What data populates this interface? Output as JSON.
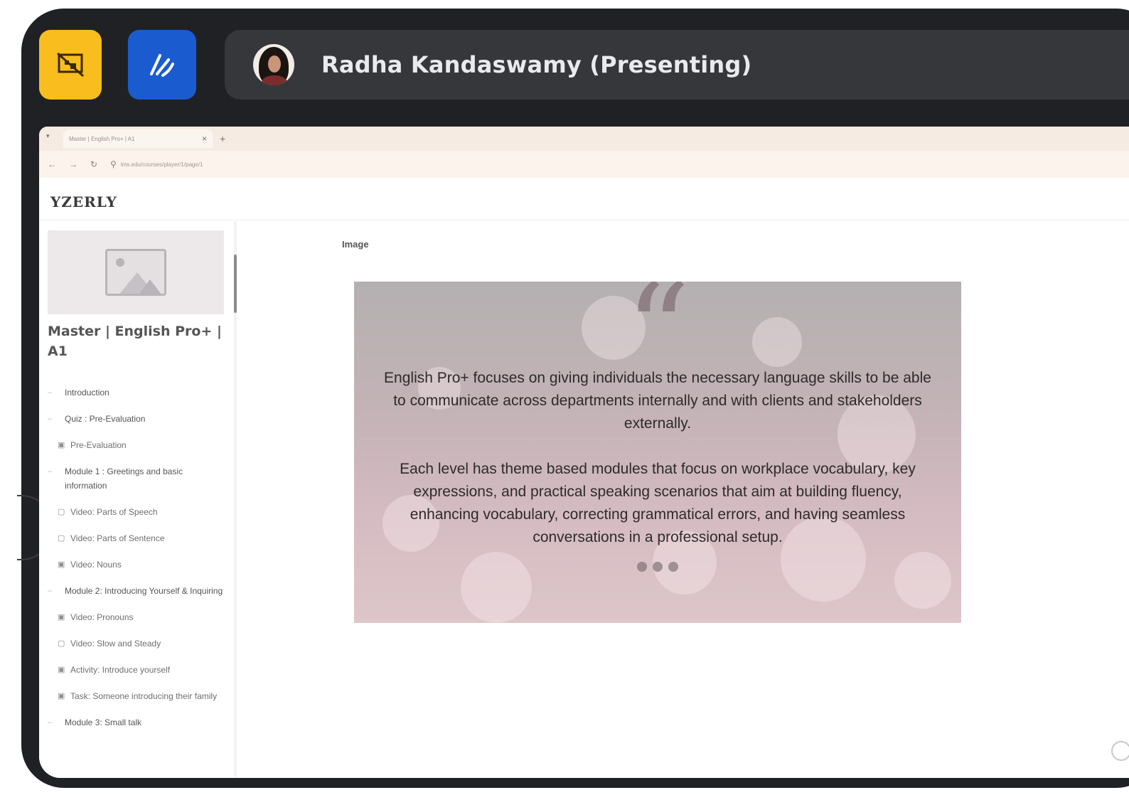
{
  "meeting": {
    "presenter_label": "Radha Kandaswamy (Presenting)",
    "accent_yellow": "#f9bd1d",
    "accent_blue": "#1a5bd0",
    "left_button_icon": "present-off-icon",
    "right_button_icon": "annotate-pen-icon"
  },
  "browser": {
    "tab_title": "Master | English Pro+ | A1",
    "url": "lms.edu/courses/player/1/page/1"
  },
  "site": {
    "logo": "YZERLY"
  },
  "sidebar": {
    "course_title": "Master | English Pro+ | A1",
    "items": [
      {
        "label": "Introduction",
        "kind": "section"
      },
      {
        "label": "Quiz : Pre-Evaluation",
        "kind": "section"
      },
      {
        "label": "Pre-Evaluation",
        "kind": "sub"
      },
      {
        "label": "Module 1 : Greetings and basic information",
        "kind": "section"
      },
      {
        "label": "Video: Parts of Speech",
        "kind": "sub"
      },
      {
        "label": "Video: Parts of Sentence",
        "kind": "sub"
      },
      {
        "label": "Video: Nouns",
        "kind": "sub"
      },
      {
        "label": "Module 2: Introducing Yourself & Inquiring",
        "kind": "section"
      },
      {
        "label": "Video: Pronouns",
        "kind": "sub"
      },
      {
        "label": "Video: Slow and Steady",
        "kind": "sub"
      },
      {
        "label": "Activity: Introduce yourself",
        "kind": "sub"
      },
      {
        "label": "Task: Someone introducing their family",
        "kind": "sub"
      },
      {
        "label": "Module 3: Small talk",
        "kind": "section"
      }
    ]
  },
  "main": {
    "image_label": "Image",
    "quote_mark": "“",
    "paragraph_1": "English Pro+ focuses on giving individuals the necessary language skills to be able to communicate across departments internally and with clients and stakeholders externally.",
    "paragraph_2": "Each level has theme based modules that focus on workplace vocabulary, key expressions, and practical speaking scenarios that aim at building fluency, enhancing vocabulary, correcting grammatical errors, and having seamless conversations in a professional setup."
  }
}
